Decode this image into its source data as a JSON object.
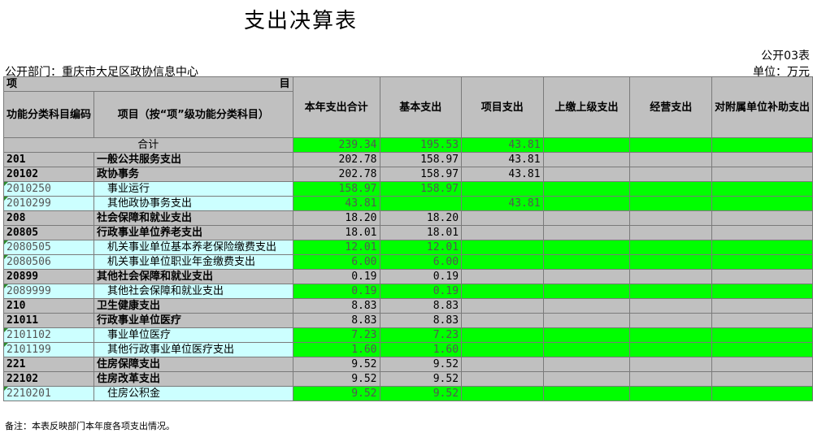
{
  "title": "支出决算表",
  "form_code": "公开03表",
  "department": "公开部门：重庆市大足区政协信息中心",
  "unit": "单位：万元",
  "header": {
    "xiang": "项",
    "mu": "目",
    "code_col": "功能分类科目编码",
    "name_col": "项目（按“项”级功能分类科目）",
    "cols": [
      "本年支出合计",
      "基本支出",
      "项目支出",
      "上缴上级支出",
      "经营支出",
      "对附属单位补助支出"
    ]
  },
  "total": {
    "label": "合计",
    "values": [
      "239.34",
      "195.53",
      "43.81",
      "",
      "",
      ""
    ]
  },
  "rows": [
    {
      "code": "201",
      "name": "一般公共服务支出",
      "values": [
        "202.78",
        "158.97",
        "43.81",
        "",
        "",
        ""
      ],
      "level": "class"
    },
    {
      "code": "20102",
      "name": "政协事务",
      "values": [
        "202.78",
        "158.97",
        "43.81",
        "",
        "",
        ""
      ],
      "level": "class"
    },
    {
      "code": "2010250",
      "name": "事业运行",
      "values": [
        "158.97",
        "158.97",
        "",
        "",
        "",
        ""
      ],
      "level": "item"
    },
    {
      "code": "2010299",
      "name": "其他政协事务支出",
      "values": [
        "43.81",
        "",
        "43.81",
        "",
        "",
        ""
      ],
      "level": "item"
    },
    {
      "code": "208",
      "name": "社会保障和就业支出",
      "values": [
        "18.20",
        "18.20",
        "",
        "",
        "",
        ""
      ],
      "level": "class"
    },
    {
      "code": "20805",
      "name": "行政事业单位养老支出",
      "values": [
        "18.01",
        "18.01",
        "",
        "",
        "",
        ""
      ],
      "level": "class"
    },
    {
      "code": "2080505",
      "name": "机关事业单位基本养老保险缴费支出",
      "values": [
        "12.01",
        "12.01",
        "",
        "",
        "",
        ""
      ],
      "level": "item"
    },
    {
      "code": "2080506",
      "name": "机关事业单位职业年金缴费支出",
      "values": [
        "6.00",
        "6.00",
        "",
        "",
        "",
        ""
      ],
      "level": "item"
    },
    {
      "code": "20899",
      "name": "其他社会保障和就业支出",
      "values": [
        "0.19",
        "0.19",
        "",
        "",
        "",
        ""
      ],
      "level": "class"
    },
    {
      "code": "2089999",
      "name": "其他社会保障和就业支出",
      "values": [
        "0.19",
        "0.19",
        "",
        "",
        "",
        ""
      ],
      "level": "item"
    },
    {
      "code": "210",
      "name": "卫生健康支出",
      "values": [
        "8.83",
        "8.83",
        "",
        "",
        "",
        ""
      ],
      "level": "class"
    },
    {
      "code": "21011",
      "name": "行政事业单位医疗",
      "values": [
        "8.83",
        "8.83",
        "",
        "",
        "",
        ""
      ],
      "level": "class"
    },
    {
      "code": "2101102",
      "name": "事业单位医疗",
      "values": [
        "7.23",
        "7.23",
        "",
        "",
        "",
        ""
      ],
      "level": "item"
    },
    {
      "code": "2101199",
      "name": "其他行政事业单位医疗支出",
      "values": [
        "1.60",
        "1.60",
        "",
        "",
        "",
        ""
      ],
      "level": "item"
    },
    {
      "code": "221",
      "name": "住房保障支出",
      "values": [
        "9.52",
        "9.52",
        "",
        "",
        "",
        ""
      ],
      "level": "class"
    },
    {
      "code": "22102",
      "name": "住房改革支出",
      "values": [
        "9.52",
        "9.52",
        "",
        "",
        "",
        ""
      ],
      "level": "class"
    },
    {
      "code": "2210201",
      "name": "住房公积金",
      "values": [
        "9.52",
        "9.52",
        "",
        "",
        "",
        ""
      ],
      "level": "item"
    }
  ],
  "note": "备注：本表反映部门本年度各项支出情况。",
  "colors": {
    "header_gray": "#c0c0c0",
    "item_cyan": "#ccffff",
    "value_green": "#00ff00"
  }
}
